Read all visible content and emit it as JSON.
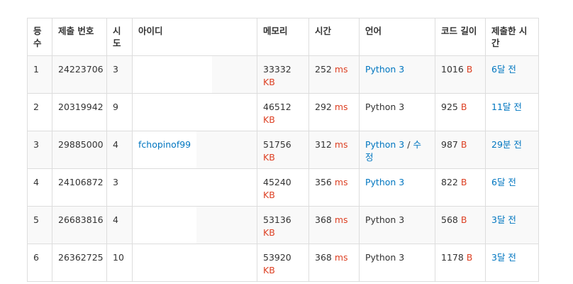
{
  "headers": {
    "rank": "등 수",
    "submit_no": "제출 번호",
    "tries": "시 도",
    "user": "아이디",
    "memory": "메모리",
    "time": "시간",
    "lang": "언어",
    "code_len": "코드 길이",
    "submitted": "제출한 시간"
  },
  "units": {
    "kb": "KB",
    "ms": "ms",
    "b": "B",
    "sep": "/"
  },
  "rows": [
    {
      "rank": "1",
      "submit_no": "24223706",
      "tries": "3",
      "user": "",
      "memory": "33332",
      "time": "252",
      "lang": "Python 3",
      "lang_link": true,
      "code_len": "1016",
      "submitted": "6달 전"
    },
    {
      "rank": "2",
      "submit_no": "20319942",
      "tries": "9",
      "user": "",
      "memory": "46512",
      "time": "292",
      "lang": "Python 3",
      "lang_link": false,
      "code_len": "925",
      "submitted": "11달 전"
    },
    {
      "rank": "3",
      "submit_no": "29885000",
      "tries": "4",
      "user": "fchopinof99",
      "memory": "51756",
      "time": "312",
      "lang": "Python 3",
      "lang_link": true,
      "lang_extra": "수정",
      "code_len": "987",
      "submitted": "29분 전"
    },
    {
      "rank": "4",
      "submit_no": "24106872",
      "tries": "3",
      "user": "",
      "memory": "45240",
      "time": "356",
      "lang": "Python 3",
      "lang_link": true,
      "code_len": "822",
      "submitted": "6달 전"
    },
    {
      "rank": "5",
      "submit_no": "26683816",
      "tries": "4",
      "user": "",
      "memory": "53136",
      "time": "368",
      "lang": "Python 3",
      "lang_link": false,
      "code_len": "568",
      "submitted": "3달 전"
    },
    {
      "rank": "6",
      "submit_no": "26362725",
      "tries": "10",
      "user": "",
      "memory": "53920",
      "time": "368",
      "lang": "Python 3",
      "lang_link": false,
      "code_len": "1178",
      "submitted": "3달 전"
    }
  ],
  "colors": {
    "link": "#0076c0",
    "accent": "#dd4124",
    "border": "#dddddd",
    "stripe": "#f9f9f9"
  }
}
